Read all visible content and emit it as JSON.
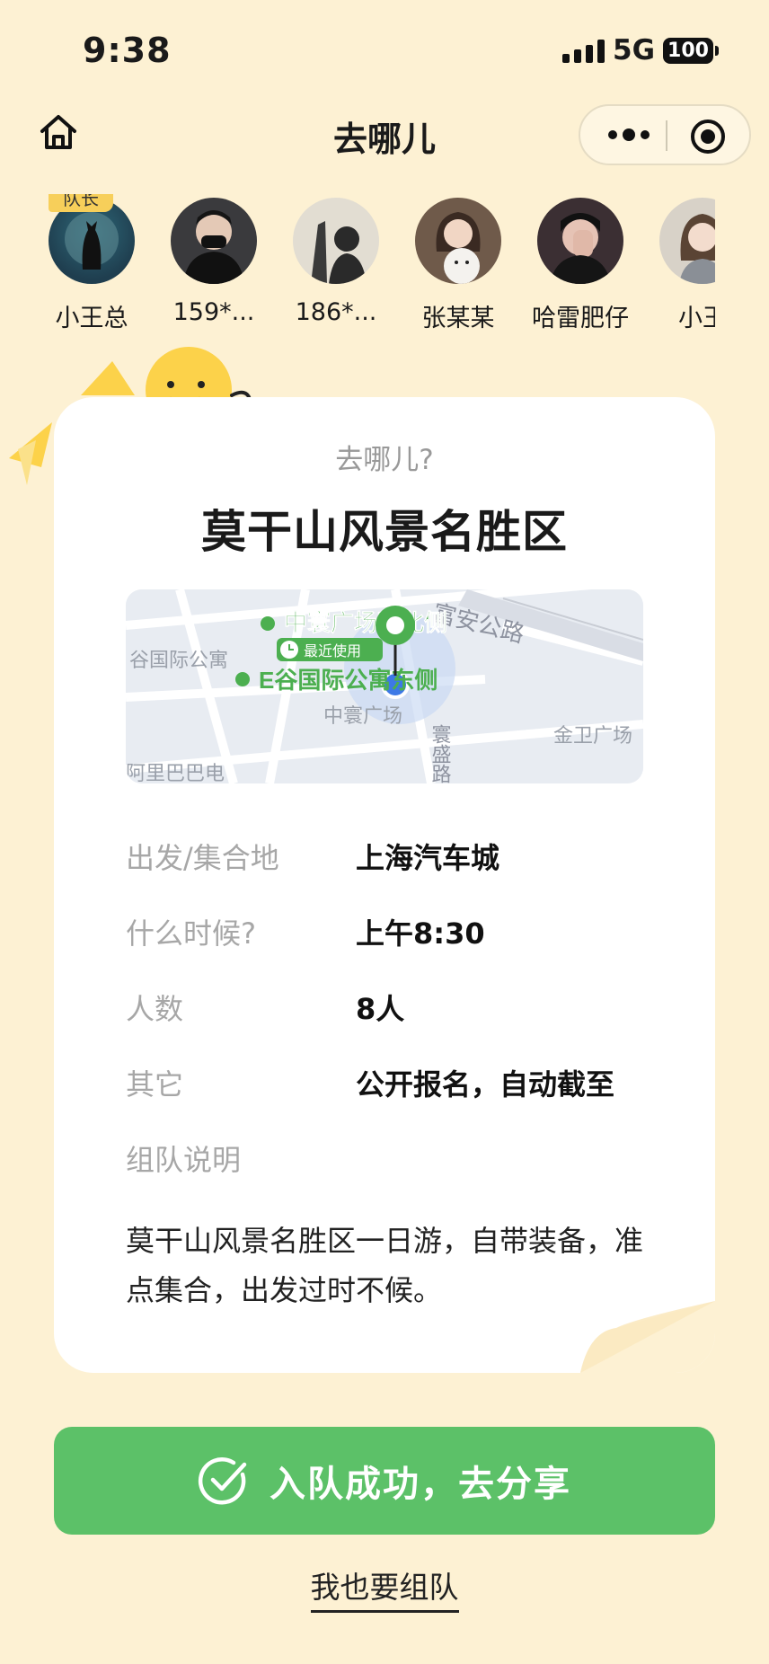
{
  "status_bar": {
    "time": "9:38",
    "network": "5G",
    "battery": "100"
  },
  "nav": {
    "title": "去哪儿"
  },
  "members": [
    {
      "name": "小王总",
      "badge": "队长",
      "avatar_color": "#1f3e4f"
    },
    {
      "name": "159*...",
      "avatar_color": "#2b2b2e"
    },
    {
      "name": "186*...",
      "avatar_color": "#d9d3c4"
    },
    {
      "name": "张某某",
      "avatar_color": "#8a6f5e"
    },
    {
      "name": "哈雷肥仔",
      "avatar_color": "#4a3a3a"
    },
    {
      "name": "小王",
      "avatar_color": "#c9b7a8"
    }
  ],
  "card": {
    "subtitle": "去哪儿?",
    "title": "莫干山风景名胜区",
    "map": {
      "labels": {
        "road_top": "富安公路",
        "poi_1": "中寰广场西北侧",
        "recent_tag": "最近使用",
        "left_area": "谷国际公寓",
        "poi_2": "E谷国际公寓东侧",
        "plaza": "中寰广场",
        "road_side": "寰盛路",
        "right_plaza": "金卫广场",
        "bottom_left": "阿里巴巴电"
      }
    },
    "info": [
      {
        "label": "出发/集合地",
        "value": "上海汽车城"
      },
      {
        "label": "什么时候?",
        "value": "上午8:30"
      },
      {
        "label": "人数",
        "value": "8人"
      },
      {
        "label": "其它",
        "value": "公开报名，自动截至"
      },
      {
        "label": "组队说明",
        "value": ""
      }
    ],
    "description": "莫干山风景名胜区一日游，自带装备，准点集合，出发过时不候。"
  },
  "actions": {
    "join_label": "入队成功，去分享",
    "team_link": "我也要组队"
  },
  "colors": {
    "background": "#fdf1d3",
    "primary_green": "#5cc168",
    "map_green": "#4caf50",
    "leader_badge": "#f7cf5a",
    "mascot_yellow": "#fcd24a"
  }
}
